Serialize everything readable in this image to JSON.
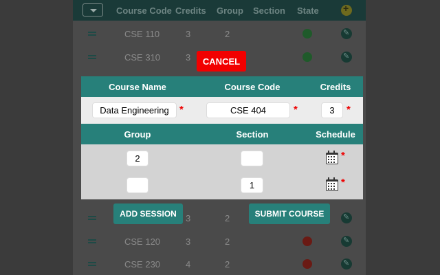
{
  "background_table": {
    "headers": [
      "Course Code",
      "Credits",
      "Group",
      "Section",
      "State"
    ],
    "rows": [
      {
        "code": "CSE 110",
        "credits": "3",
        "group": "2",
        "state": "ok"
      },
      {
        "code": "CSE 310",
        "credits": "3",
        "group": "",
        "state": "ok"
      },
      {
        "code": "",
        "credits": "3",
        "group": "2",
        "state": ""
      },
      {
        "code": "CSE 120",
        "credits": "3",
        "group": "2",
        "state": "error"
      },
      {
        "code": "CSE 230",
        "credits": "4",
        "group": "2",
        "state": "error"
      }
    ]
  },
  "cancel_label": "Cancel",
  "course_header": {
    "name": "Course Name",
    "code": "Course Code",
    "credits": "Credits"
  },
  "course": {
    "name": "Data Engineering",
    "code": "CSE 404",
    "credits": "3"
  },
  "session_header": {
    "group": "Group",
    "section": "Section",
    "schedule": "Schedule"
  },
  "sessions": [
    {
      "group": "2",
      "section": ""
    },
    {
      "group": "",
      "section": "1"
    }
  ],
  "required_mark": "*",
  "add_session_label": "Add Session",
  "submit_label": "Submit Course",
  "colors": {
    "teal": "#27807a",
    "cancel": "#f20000",
    "required": "#e00000"
  }
}
